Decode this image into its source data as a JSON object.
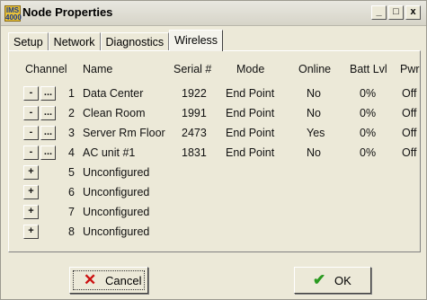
{
  "window": {
    "title": "Node Properties",
    "app_icon_text": "IMS\n4000",
    "controls": {
      "minimize": "_",
      "maximize": "□",
      "close": "x"
    }
  },
  "tabs": [
    {
      "label": "Setup",
      "active": false
    },
    {
      "label": "Network",
      "active": false
    },
    {
      "label": "Diagnostics",
      "active": false
    },
    {
      "label": "Wireless",
      "active": true
    }
  ],
  "table": {
    "headers": {
      "channel": "Channel",
      "name": "Name",
      "serial": "Serial #",
      "mode": "Mode",
      "online": "Online",
      "batt": "Batt Lvl",
      "pwr": "Pwr"
    },
    "rows": [
      {
        "ch": "1",
        "name": "Data Center",
        "serial": "1922",
        "mode": "End Point",
        "online": "No",
        "batt": "0%",
        "pwr": "Off",
        "configured": true
      },
      {
        "ch": "2",
        "name": "Clean Room",
        "serial": "1991",
        "mode": "End Point",
        "online": "No",
        "batt": "0%",
        "pwr": "Off",
        "configured": true
      },
      {
        "ch": "3",
        "name": "Server Rm Floor",
        "serial": "2473",
        "mode": "End Point",
        "online": "Yes",
        "batt": "0%",
        "pwr": "Off",
        "configured": true
      },
      {
        "ch": "4",
        "name": "AC unit #1",
        "serial": "1831",
        "mode": "End Point",
        "online": "No",
        "batt": "0%",
        "pwr": "Off",
        "configured": true
      },
      {
        "ch": "5",
        "name": "Unconfigured",
        "configured": false
      },
      {
        "ch": "6",
        "name": "Unconfigured",
        "configured": false
      },
      {
        "ch": "7",
        "name": "Unconfigured",
        "configured": false
      },
      {
        "ch": "8",
        "name": "Unconfigured",
        "configured": false
      }
    ],
    "button_labels": {
      "remove": "-",
      "edit": "...",
      "add": "+"
    }
  },
  "footer": {
    "cancel_label": "Cancel",
    "ok_label": "OK",
    "cancel_icon_color": "#cc1010",
    "ok_icon_color": "#2a9a20"
  }
}
